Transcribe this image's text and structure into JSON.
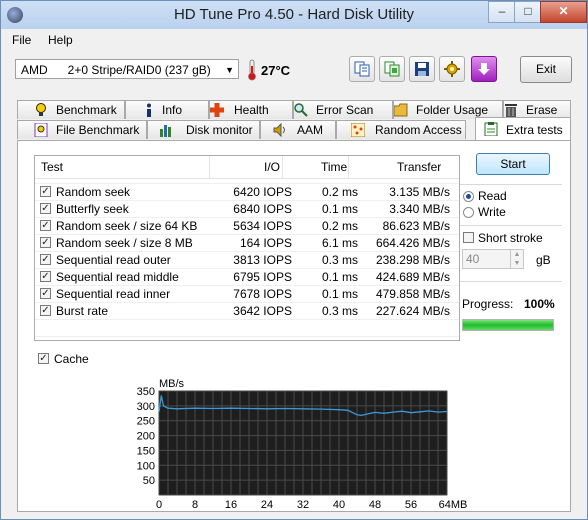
{
  "window": {
    "title": "HD Tune Pro 4.50 - Hard Disk Utility",
    "minimize": "–",
    "maximize": "□",
    "close": "✕"
  },
  "menu": [
    "File",
    "Help"
  ],
  "toolbar": {
    "drive": "AMD      2+0 Stripe/RAID0 (237 gB)",
    "temperature": "27°C",
    "buttons": [
      "copy-text-icon",
      "copy-screenshot-icon",
      "save-icon",
      "options-icon",
      "download-icon"
    ],
    "exit_label": "Exit"
  },
  "tabs_top": [
    "Benchmark",
    "Info",
    "Health",
    "Error Scan",
    "Folder Usage",
    "Erase"
  ],
  "tabs_bottom": [
    "File Benchmark",
    "Disk monitor",
    "AAM",
    "Random Access",
    "Extra tests"
  ],
  "active_tab": "Extra tests",
  "table": {
    "headers": [
      "Test",
      "I/O",
      "Time",
      "Transfer"
    ],
    "rows": [
      {
        "checked": true,
        "test": "Random seek",
        "io": "6420 IOPS",
        "time": "0.2 ms",
        "transfer": "3.135 MB/s"
      },
      {
        "checked": true,
        "test": "Butterfly seek",
        "io": "6840 IOPS",
        "time": "0.1 ms",
        "transfer": "3.340 MB/s"
      },
      {
        "checked": true,
        "test": "Random seek / size 64 KB",
        "io": "5634 IOPS",
        "time": "0.2 ms",
        "transfer": "86.623 MB/s"
      },
      {
        "checked": true,
        "test": "Random seek / size 8 MB",
        "io": "164 IOPS",
        "time": "6.1 ms",
        "transfer": "664.426 MB/s"
      },
      {
        "checked": true,
        "test": "Sequential read outer",
        "io": "3813 IOPS",
        "time": "0.3 ms",
        "transfer": "238.298 MB/s"
      },
      {
        "checked": true,
        "test": "Sequential read middle",
        "io": "6795 IOPS",
        "time": "0.1 ms",
        "transfer": "424.689 MB/s"
      },
      {
        "checked": true,
        "test": "Sequential read inner",
        "io": "7678 IOPS",
        "time": "0.1 ms",
        "transfer": "479.858 MB/s"
      },
      {
        "checked": true,
        "test": "Burst rate",
        "io": "3642 IOPS",
        "time": "0.3 ms",
        "transfer": "227.624 MB/s"
      }
    ]
  },
  "controls": {
    "start_label": "Start",
    "read_label": "Read",
    "write_label": "Write",
    "mode_selected": "Read",
    "short_stroke_label": "Short stroke",
    "short_stroke_checked": false,
    "stroke_value": "40",
    "stroke_unit": "gB",
    "progress_label": "Progress:",
    "progress_value": "100%",
    "progress_fraction": 1.0,
    "cache_label": "Cache",
    "cache_checked": true
  },
  "colors": {
    "accent_blue": "#3a9ad9",
    "progress_green": "#1ebd2a",
    "chart_bg": "#1e1e1e"
  },
  "chart_data": {
    "type": "line",
    "ylabel": "MB/s",
    "xlabel": "",
    "x_unit": "MB",
    "yticks": [
      50,
      100,
      150,
      200,
      250,
      300,
      350
    ],
    "xticks": [
      "0",
      "8",
      "16",
      "24",
      "32",
      "40",
      "48",
      "56",
      "64MB"
    ],
    "ylim": [
      0,
      350
    ],
    "xlim": [
      0,
      64
    ],
    "grid": true,
    "series": [
      {
        "x": [
          0,
          0.5,
          1,
          2,
          4,
          8,
          12,
          16,
          20,
          24,
          28,
          32,
          36,
          40,
          42,
          44,
          45,
          46,
          48,
          50,
          52,
          54,
          56,
          58,
          60,
          62,
          64
        ],
        "values": [
          280,
          335,
          300,
          292,
          290,
          292,
          291,
          292,
          291,
          290,
          291,
          290,
          289,
          287,
          285,
          270,
          268,
          272,
          278,
          275,
          279,
          282,
          277,
          280,
          283,
          279,
          281
        ]
      }
    ]
  }
}
